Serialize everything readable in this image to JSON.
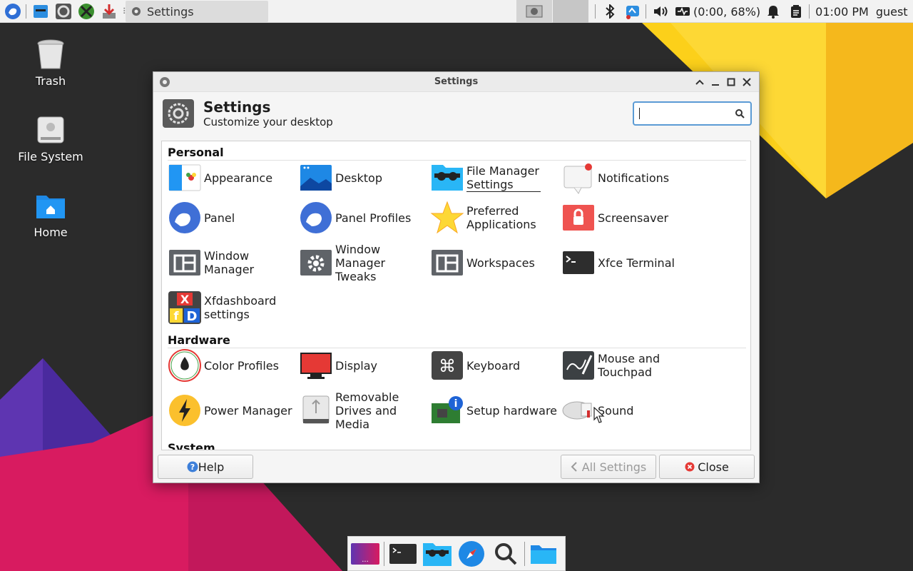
{
  "colors": {
    "wallpaper_base": "#2b2b2b",
    "yellow": "#fcd01a",
    "pink": "#d81b60",
    "purple": "#5e35b1",
    "accent": "#5b9bd5"
  },
  "top_panel": {
    "launchers": [
      "xfce-menu-icon",
      "file-manager-icon",
      "settings-icon",
      "xfce-xapp-icon",
      "download-icon"
    ],
    "task_window_title": "Settings",
    "tray": {
      "battery_text": "(0:00, 68%)",
      "clock": "01:00 PM",
      "user": "guest"
    }
  },
  "desktop_icons": [
    {
      "label": "Trash",
      "icon": "trash-icon"
    },
    {
      "label": "File System",
      "icon": "hard-drive-icon"
    },
    {
      "label": "Home",
      "icon": "home-folder-icon"
    }
  ],
  "window": {
    "title": "Settings",
    "header_title": "Settings",
    "header_subtitle": "Customize your desktop",
    "search_placeholder": "",
    "categories": [
      {
        "name": "Personal",
        "items": [
          {
            "label": "Appearance",
            "icon": "appearance-icon"
          },
          {
            "label": "Desktop",
            "icon": "desktop-icon"
          },
          {
            "label": "File Manager Settings",
            "icon": "file-manager-icon"
          },
          {
            "label": "Notifications",
            "icon": "notifications-icon"
          },
          {
            "label": "Panel",
            "icon": "panel-icon"
          },
          {
            "label": "Panel Profiles",
            "icon": "panel-profiles-icon"
          },
          {
            "label": "Preferred Applications",
            "icon": "star-icon"
          },
          {
            "label": "Screensaver",
            "icon": "screensaver-icon"
          },
          {
            "label": "Window Manager",
            "icon": "window-manager-icon"
          },
          {
            "label": "Window Manager Tweaks",
            "icon": "gear-icon"
          },
          {
            "label": "Workspaces",
            "icon": "workspaces-icon"
          },
          {
            "label": "Xfce Terminal",
            "icon": "terminal-icon"
          },
          {
            "label": "Xfdashboard settings",
            "icon": "xfdashboard-icon"
          }
        ]
      },
      {
        "name": "Hardware",
        "items": [
          {
            "label": "Color Profiles",
            "icon": "color-profiles-icon"
          },
          {
            "label": "Display",
            "icon": "display-icon"
          },
          {
            "label": "Keyboard",
            "icon": "keyboard-icon"
          },
          {
            "label": "Mouse and Touchpad",
            "icon": "mouse-icon"
          },
          {
            "label": "Power Manager",
            "icon": "power-icon"
          },
          {
            "label": "Removable Drives and Media",
            "icon": "usb-drive-icon"
          },
          {
            "label": "Setup hardware",
            "icon": "hardware-icon"
          },
          {
            "label": "Sound",
            "icon": "sound-icon"
          }
        ]
      },
      {
        "name": "System",
        "items": []
      }
    ],
    "help_label": "Help",
    "all_settings_label": "All Settings",
    "close_label": "Close"
  },
  "dock": [
    "workspace-switcher-icon",
    "terminal-icon",
    "file-manager-icon",
    "web-browser-icon",
    "app-finder-icon",
    "folder-icon"
  ]
}
